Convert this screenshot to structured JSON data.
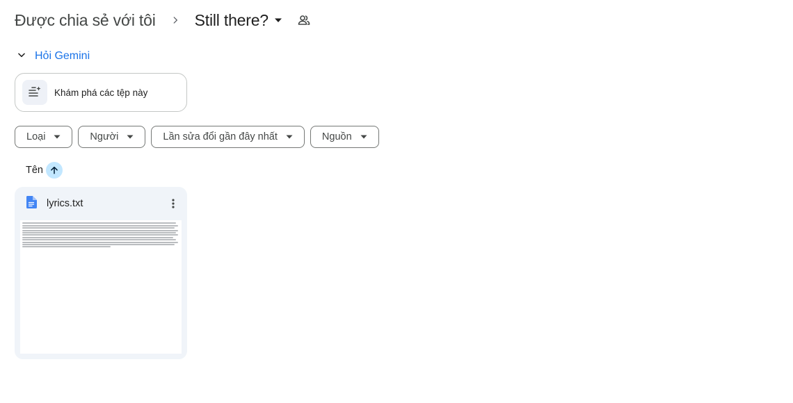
{
  "breadcrumb": {
    "root": "Được chia sẻ với tôi",
    "current": "Still there?"
  },
  "icons": {
    "separator": "chevron-right-icon",
    "caret": "arrow-drop-down-icon",
    "shared": "people-icon",
    "gemini_toggle": "chevron-down-icon",
    "explore": "spark-list-icon",
    "sort": "arrow-up-icon",
    "file": "doc-icon",
    "more": "more-vert-icon"
  },
  "gemini": {
    "label": "Hỏi Gemini",
    "explore_label": "Khám phá các tệp này"
  },
  "filters": [
    {
      "label": "Loại"
    },
    {
      "label": "Người"
    },
    {
      "label": "Lần sửa đổi gần đây nhất"
    },
    {
      "label": "Nguồn"
    }
  ],
  "sort": {
    "label": "Tên",
    "direction": "ascending"
  },
  "files": [
    {
      "name": "lyrics.txt",
      "type": "text",
      "icon_color": "#4285f4"
    }
  ],
  "colors": {
    "accent": "#1a73e8",
    "sort_chip_bg": "#c2e7ff",
    "card_bg": "#f0f4f9"
  }
}
